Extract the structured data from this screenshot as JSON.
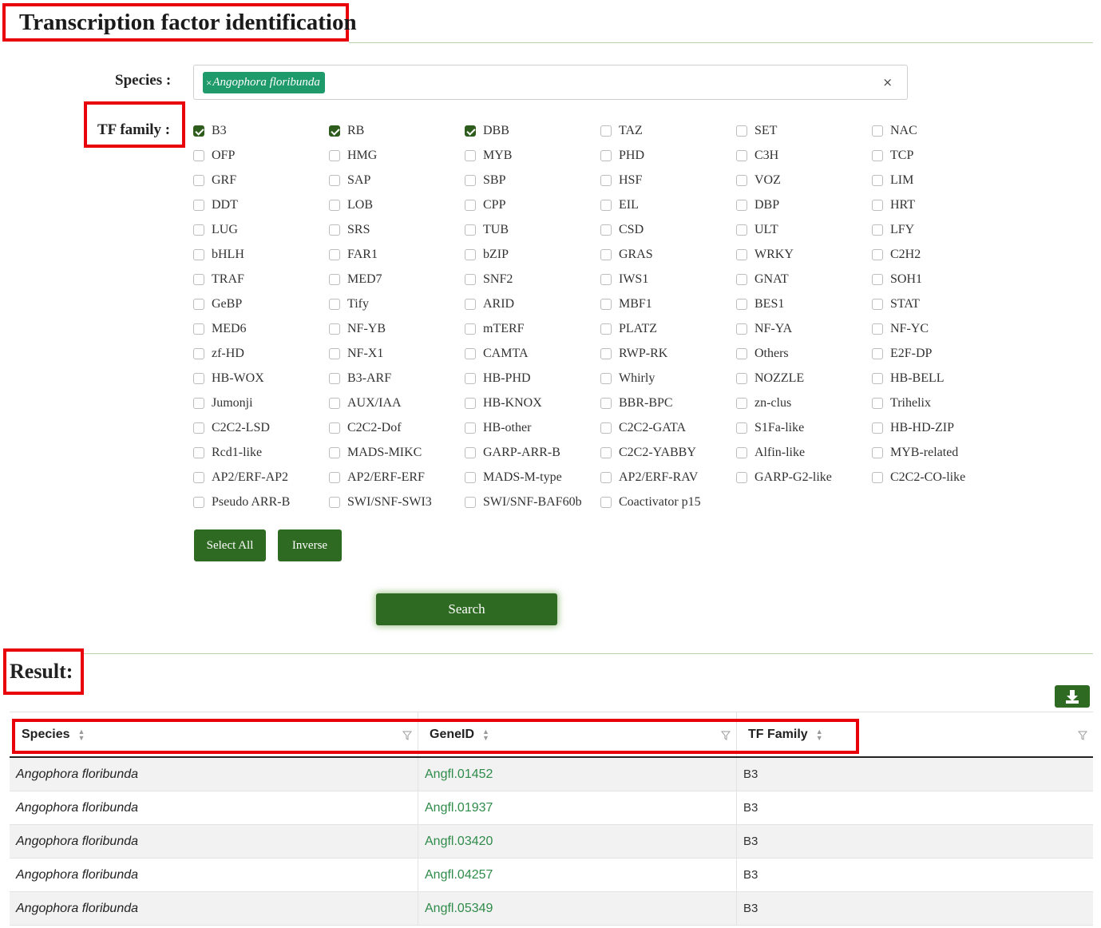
{
  "page_title": "Transcription factor identification",
  "species_label": "Species :",
  "species_tag": "Angophora floribunda",
  "tag_remove": "×",
  "clear_button": "×",
  "tf_family_label": "TF family :",
  "tf_families": [
    {
      "name": "B3",
      "checked": true
    },
    {
      "name": "RB",
      "checked": true
    },
    {
      "name": "DBB",
      "checked": true
    },
    {
      "name": "TAZ",
      "checked": false
    },
    {
      "name": "SET",
      "checked": false
    },
    {
      "name": "NAC",
      "checked": false
    },
    {
      "name": "OFP",
      "checked": false
    },
    {
      "name": "HMG",
      "checked": false
    },
    {
      "name": "MYB",
      "checked": false
    },
    {
      "name": "PHD",
      "checked": false
    },
    {
      "name": "C3H",
      "checked": false
    },
    {
      "name": "TCP",
      "checked": false
    },
    {
      "name": "GRF",
      "checked": false
    },
    {
      "name": "SAP",
      "checked": false
    },
    {
      "name": "SBP",
      "checked": false
    },
    {
      "name": "HSF",
      "checked": false
    },
    {
      "name": "VOZ",
      "checked": false
    },
    {
      "name": "LIM",
      "checked": false
    },
    {
      "name": "DDT",
      "checked": false
    },
    {
      "name": "LOB",
      "checked": false
    },
    {
      "name": "CPP",
      "checked": false
    },
    {
      "name": "EIL",
      "checked": false
    },
    {
      "name": "DBP",
      "checked": false
    },
    {
      "name": "HRT",
      "checked": false
    },
    {
      "name": "LUG",
      "checked": false
    },
    {
      "name": "SRS",
      "checked": false
    },
    {
      "name": "TUB",
      "checked": false
    },
    {
      "name": "CSD",
      "checked": false
    },
    {
      "name": "ULT",
      "checked": false
    },
    {
      "name": "LFY",
      "checked": false
    },
    {
      "name": "bHLH",
      "checked": false
    },
    {
      "name": "FAR1",
      "checked": false
    },
    {
      "name": "bZIP",
      "checked": false
    },
    {
      "name": "GRAS",
      "checked": false
    },
    {
      "name": "WRKY",
      "checked": false
    },
    {
      "name": "C2H2",
      "checked": false
    },
    {
      "name": "TRAF",
      "checked": false
    },
    {
      "name": "MED7",
      "checked": false
    },
    {
      "name": "SNF2",
      "checked": false
    },
    {
      "name": "IWS1",
      "checked": false
    },
    {
      "name": "GNAT",
      "checked": false
    },
    {
      "name": "SOH1",
      "checked": false
    },
    {
      "name": "GeBP",
      "checked": false
    },
    {
      "name": "Tify",
      "checked": false
    },
    {
      "name": "ARID",
      "checked": false
    },
    {
      "name": "MBF1",
      "checked": false
    },
    {
      "name": "BES1",
      "checked": false
    },
    {
      "name": "STAT",
      "checked": false
    },
    {
      "name": "MED6",
      "checked": false
    },
    {
      "name": "NF-YB",
      "checked": false
    },
    {
      "name": "mTERF",
      "checked": false
    },
    {
      "name": "PLATZ",
      "checked": false
    },
    {
      "name": "NF-YA",
      "checked": false
    },
    {
      "name": "NF-YC",
      "checked": false
    },
    {
      "name": "zf-HD",
      "checked": false
    },
    {
      "name": "NF-X1",
      "checked": false
    },
    {
      "name": "CAMTA",
      "checked": false
    },
    {
      "name": "RWP-RK",
      "checked": false
    },
    {
      "name": "Others",
      "checked": false
    },
    {
      "name": "E2F-DP",
      "checked": false
    },
    {
      "name": "HB-WOX",
      "checked": false
    },
    {
      "name": "B3-ARF",
      "checked": false
    },
    {
      "name": "HB-PHD",
      "checked": false
    },
    {
      "name": "Whirly",
      "checked": false
    },
    {
      "name": "NOZZLE",
      "checked": false
    },
    {
      "name": "HB-BELL",
      "checked": false
    },
    {
      "name": "Jumonji",
      "checked": false
    },
    {
      "name": "AUX/IAA",
      "checked": false
    },
    {
      "name": "HB-KNOX",
      "checked": false
    },
    {
      "name": "BBR-BPC",
      "checked": false
    },
    {
      "name": "zn-clus",
      "checked": false
    },
    {
      "name": "Trihelix",
      "checked": false
    },
    {
      "name": "C2C2-LSD",
      "checked": false
    },
    {
      "name": "C2C2-Dof",
      "checked": false
    },
    {
      "name": "HB-other",
      "checked": false
    },
    {
      "name": "C2C2-GATA",
      "checked": false
    },
    {
      "name": "S1Fa-like",
      "checked": false
    },
    {
      "name": "HB-HD-ZIP",
      "checked": false
    },
    {
      "name": "Rcd1-like",
      "checked": false
    },
    {
      "name": "MADS-MIKC",
      "checked": false
    },
    {
      "name": "GARP-ARR-B",
      "checked": false
    },
    {
      "name": "C2C2-YABBY",
      "checked": false
    },
    {
      "name": "Alfin-like",
      "checked": false
    },
    {
      "name": "MYB-related",
      "checked": false
    },
    {
      "name": "AP2/ERF-AP2",
      "checked": false
    },
    {
      "name": "AP2/ERF-ERF",
      "checked": false
    },
    {
      "name": "MADS-M-type",
      "checked": false
    },
    {
      "name": "AP2/ERF-RAV",
      "checked": false
    },
    {
      "name": "GARP-G2-like",
      "checked": false
    },
    {
      "name": "C2C2-CO-like",
      "checked": false
    },
    {
      "name": "Pseudo ARR-B",
      "checked": false
    },
    {
      "name": "SWI/SNF-SWI3",
      "checked": false
    },
    {
      "name": "SWI/SNF-BAF60b",
      "checked": false
    },
    {
      "name": "Coactivator p15",
      "checked": false
    }
  ],
  "select_all_label": "Select All",
  "inverse_label": "Inverse",
  "search_label": "Search",
  "result_label": "Result:",
  "table": {
    "columns": [
      "Species",
      "GeneID",
      "TF Family"
    ],
    "rows": [
      [
        "Angophora floribunda",
        "Angfl.01452",
        "B3"
      ],
      [
        "Angophora floribunda",
        "Angfl.01937",
        "B3"
      ],
      [
        "Angophora floribunda",
        "Angfl.03420",
        "B3"
      ],
      [
        "Angophora floribunda",
        "Angfl.04257",
        "B3"
      ],
      [
        "Angophora floribunda",
        "Angfl.05349",
        "B3"
      ]
    ]
  },
  "colors": {
    "accent_green": "#2f6a22",
    "tag_green": "#1f9a6a",
    "link_green": "#2e8b4a",
    "highlight_red": "#e8000b"
  },
  "icons": {
    "download": "download-icon",
    "sort": "sort-icon",
    "filter": "filter-icon"
  }
}
